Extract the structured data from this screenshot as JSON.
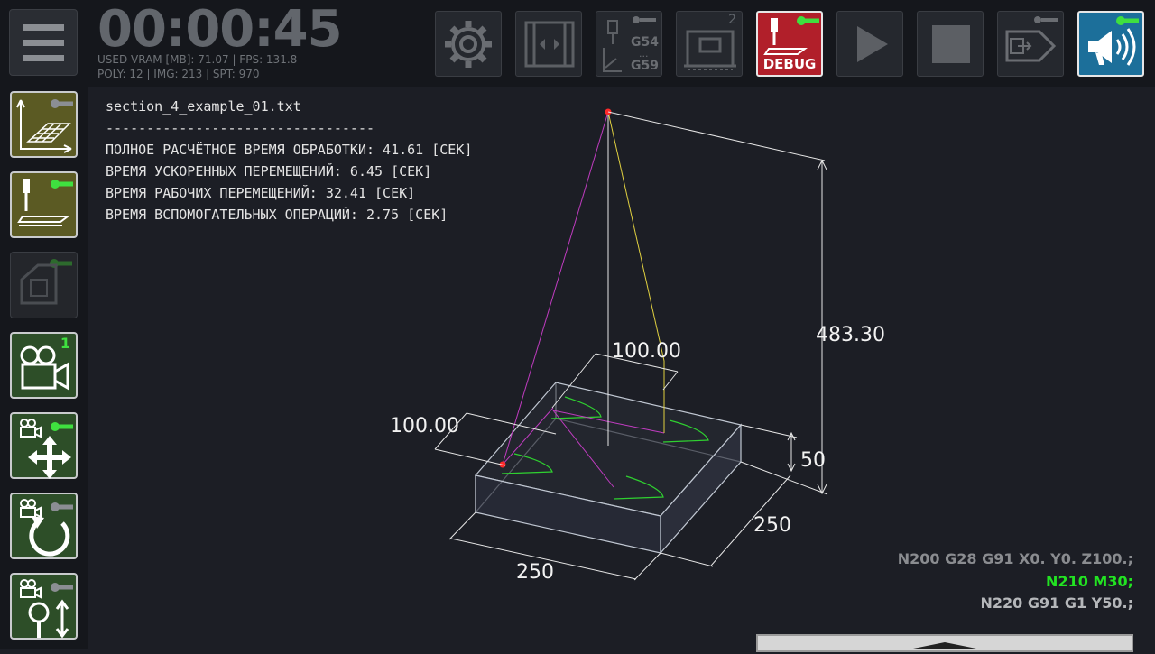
{
  "header": {
    "timer": "00:00:45",
    "stats_line1": "USED VRAM [MB]: 71.07 | FPS: 131.8",
    "stats_line2": "POLY: 12 | IMG: 213 | SPT: 970"
  },
  "toolbar": {
    "gear_icon": "gear-icon",
    "work_offset_badge_top": "G54",
    "work_offset_badge_bottom": "G59",
    "machine_count": "2",
    "debug_label": "DEBUG"
  },
  "sidebar": {
    "camera_count": "1"
  },
  "info": {
    "filename": "section_4_example_01.txt",
    "separator": "---------------------------------",
    "total_time": "ПОЛНОЕ РАСЧЁТНОЕ ВРЕМЯ ОБРАБОТКИ: 41.61 [СЕК]",
    "rapid_time": "ВРЕМЯ УСКОРЕННЫХ ПЕРЕМЕЩЕНИЙ: 6.45 [СЕК]",
    "feed_time": "ВРЕМЯ РАБОЧИХ ПЕРЕМЕЩЕНИЙ: 32.41 [СЕК]",
    "aux_time": "ВРЕМЯ ВСПОМОГАТЕЛЬНЫХ ОПЕРАЦИЙ: 2.75 [СЕК]"
  },
  "viewport": {
    "dim_height": "483.30",
    "dim_top_width": "100.00",
    "dim_top_depth": "100.00",
    "dim_block_height": "50",
    "dim_block_depth": "250",
    "dim_block_width": "250"
  },
  "gcode": {
    "prev_line": "N200 G28 G91 X0. Y0. Z100.;",
    "current_line": "N210 M30;",
    "next_line": "N220 G91 G1 Y50.;"
  },
  "colors": {
    "background": "#1c1e25",
    "panel": "#15171c",
    "active_green": "#3fe03f",
    "debug_red": "#b11f2a",
    "sound_blue": "#1c6f9a",
    "toolpath_magenta": "#c03cc0",
    "toolpath_yellow": "#e0d040",
    "arc_green": "#2fd030"
  }
}
